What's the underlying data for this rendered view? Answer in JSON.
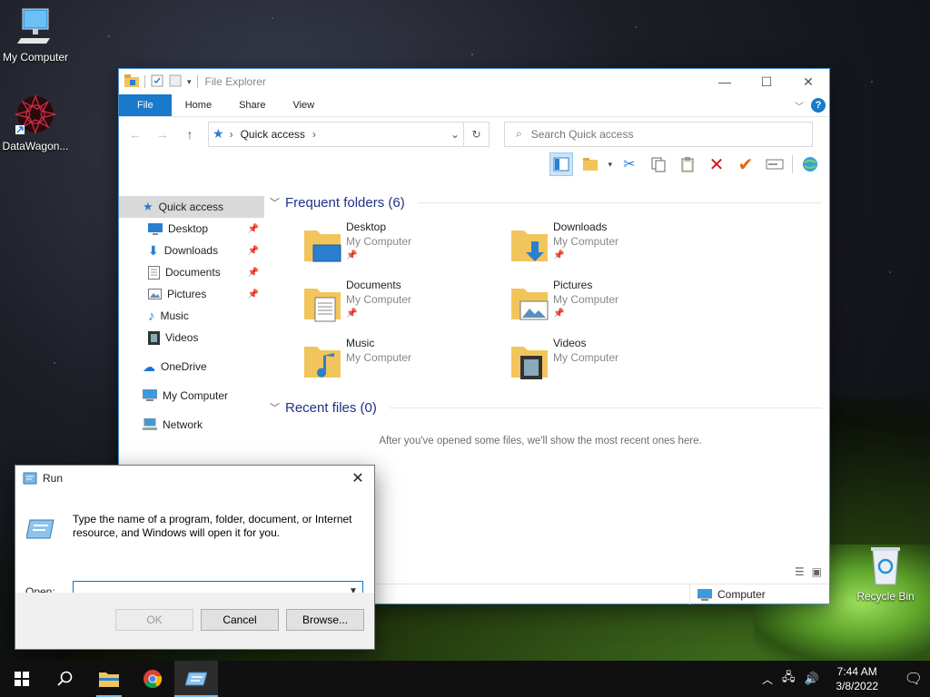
{
  "desktop": {
    "icons": [
      {
        "label": "My Computer"
      },
      {
        "label": "DataWagon..."
      },
      {
        "label": "Recycle Bin"
      }
    ]
  },
  "explorer": {
    "window_title": "File Explorer",
    "tabs": [
      "File",
      "Home",
      "Share",
      "View"
    ],
    "address": "Quick access",
    "search_placeholder": "Search Quick access",
    "nav": {
      "quick_access": "Quick access",
      "items": [
        "Desktop",
        "Downloads",
        "Documents",
        "Pictures",
        "Music",
        "Videos"
      ],
      "onedrive": "OneDrive",
      "my_computer": "My Computer",
      "network": "Network"
    },
    "frequent_header": "Frequent folders (6)",
    "folders": [
      {
        "name": "Desktop",
        "location": "My Computer"
      },
      {
        "name": "Downloads",
        "location": "My Computer"
      },
      {
        "name": "Documents",
        "location": "My Computer"
      },
      {
        "name": "Pictures",
        "location": "My Computer"
      },
      {
        "name": "Music",
        "location": "My Computer"
      },
      {
        "name": "Videos",
        "location": "My Computer"
      }
    ],
    "recent_header": "Recent files (0)",
    "recent_note": "After you've opened some files, we'll show the most recent ones here.",
    "status_location": "Computer"
  },
  "run": {
    "title": "Run",
    "description": "Type the name of a program, folder, document, or Internet resource, and Windows will open it for you.",
    "open_label": "Open:",
    "open_value": "",
    "ok": "OK",
    "cancel": "Cancel",
    "browse": "Browse..."
  },
  "taskbar": {
    "time": "7:44 AM",
    "date": "3/8/2022"
  }
}
